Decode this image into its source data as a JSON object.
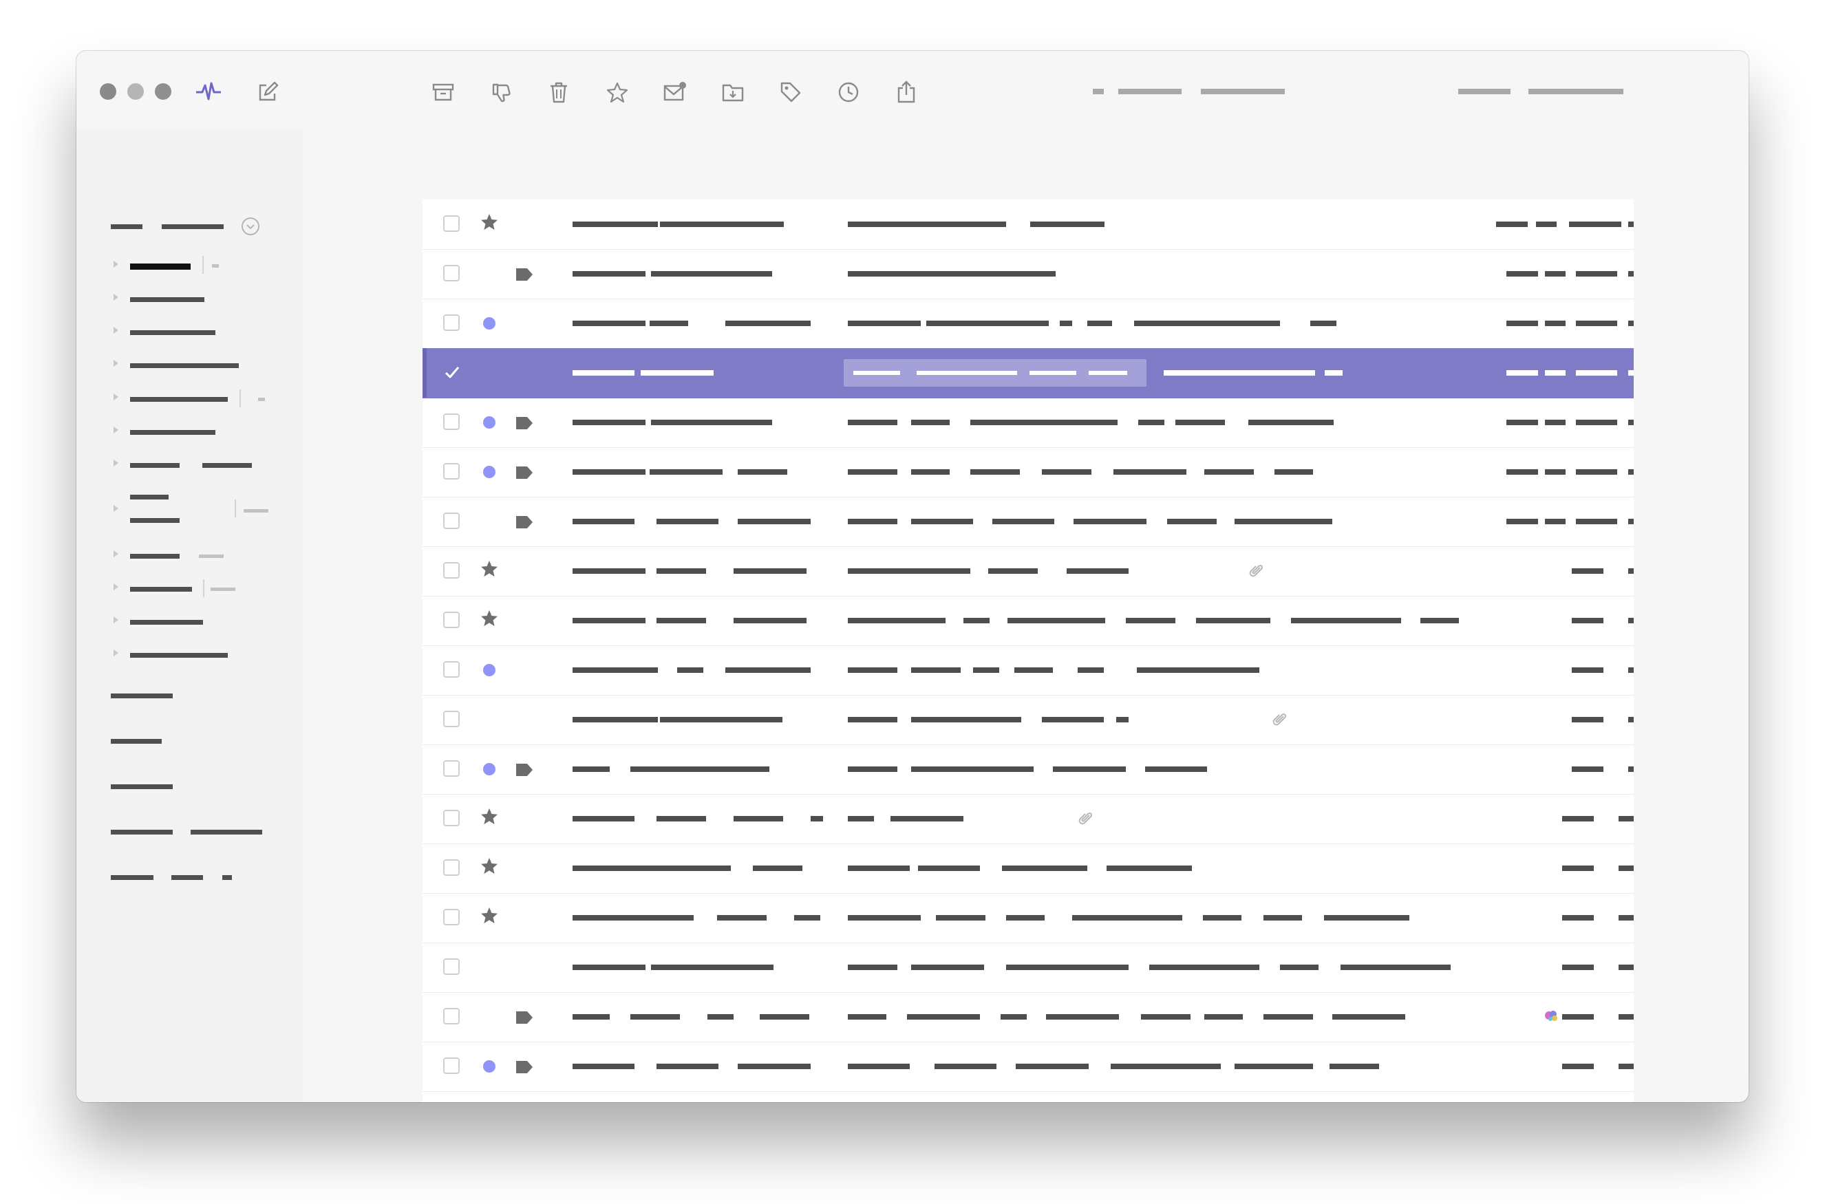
{
  "window": {
    "traffic_lights": [
      "close",
      "minimize",
      "maximize"
    ]
  },
  "toolbar": {
    "app_icon": "activity-pulse-icon",
    "compose_icon": "compose-icon",
    "actions": [
      "archive-icon",
      "thumbs-down-icon",
      "trash-icon",
      "star-icon",
      "mark-unread-icon",
      "move-to-folder-icon",
      "tag-icon",
      "snooze-clock-icon",
      "share-icon"
    ]
  },
  "sidebar": {
    "account_chevron_icon": "chevron-down-icon",
    "folders_expandable": 12,
    "sections": 5
  },
  "message_list": {
    "accent_color": "#7f7bc6",
    "unread_dot_color": "#8d95f8",
    "selected_row": 3,
    "rows": [
      {
        "checked": false,
        "starred": true,
        "unread": false,
        "tagged": false,
        "attachment": false
      },
      {
        "checked": false,
        "starred": false,
        "unread": false,
        "tagged": true,
        "attachment": false
      },
      {
        "checked": false,
        "starred": false,
        "unread": true,
        "tagged": false,
        "attachment": false
      },
      {
        "checked": true,
        "starred": false,
        "unread": false,
        "tagged": false,
        "attachment": false
      },
      {
        "checked": false,
        "starred": false,
        "unread": true,
        "tagged": true,
        "attachment": false
      },
      {
        "checked": false,
        "starred": false,
        "unread": true,
        "tagged": true,
        "attachment": false
      },
      {
        "checked": false,
        "starred": false,
        "unread": false,
        "tagged": true,
        "attachment": false
      },
      {
        "checked": false,
        "starred": true,
        "unread": false,
        "tagged": false,
        "attachment": true
      },
      {
        "checked": false,
        "starred": true,
        "unread": false,
        "tagged": false,
        "attachment": false
      },
      {
        "checked": false,
        "starred": false,
        "unread": true,
        "tagged": false,
        "attachment": false
      },
      {
        "checked": false,
        "starred": false,
        "unread": false,
        "tagged": false,
        "attachment": true
      },
      {
        "checked": false,
        "starred": false,
        "unread": true,
        "tagged": true,
        "attachment": false
      },
      {
        "checked": false,
        "starred": true,
        "unread": false,
        "tagged": false,
        "attachment": true
      },
      {
        "checked": false,
        "starred": true,
        "unread": false,
        "tagged": false,
        "attachment": false
      },
      {
        "checked": false,
        "starred": true,
        "unread": false,
        "tagged": false,
        "attachment": false
      },
      {
        "checked": false,
        "starred": false,
        "unread": false,
        "tagged": false,
        "attachment": false
      },
      {
        "checked": false,
        "starred": false,
        "unread": false,
        "tagged": true,
        "attachment": true
      },
      {
        "checked": false,
        "starred": false,
        "unread": true,
        "tagged": true,
        "attachment": false
      }
    ]
  }
}
